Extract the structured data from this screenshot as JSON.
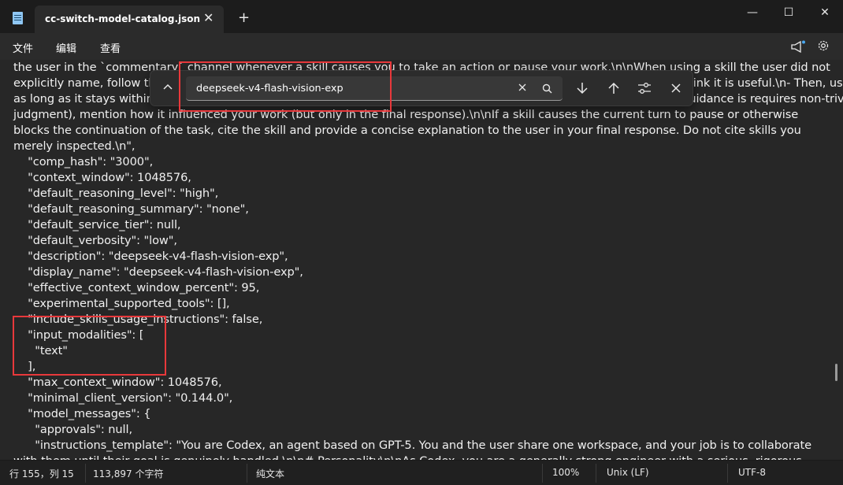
{
  "window": {
    "tab_title": "cc-switch-model-catalog.json",
    "tab_close": "✕",
    "new_tab": "+",
    "minimize": "—",
    "maximize": "☐",
    "close": "✕"
  },
  "menu": {
    "file": "文件",
    "edit": "编辑",
    "view": "查看"
  },
  "find": {
    "query": "deepseek-v4-flash-vision-exp"
  },
  "editor": {
    "lines": [
      "the user in the `commentary` channel whenever a skill causes you to take an action or pause your work.\\n\\nWhen using a skill the user did not",
      "explicitly name, follow the skill's procedure, but briefly tell the user why you are using it. Only cite the skill when you think it is useful.\\n- Then, use the skill",
      "as long as it stays within the scope of the user's request. If applying it requires judgment (for example, when a skill's guidance is requires non-trivial",
      "judgment), mention how it influenced your work (but only in the final response).\\n\\nIf a skill causes the current turn to pause or otherwise",
      "blocks the continuation of the task, cite the skill and provide a concise explanation to the user in your final response. Do not cite skills you",
      "merely inspected.\\n\",",
      "    \"comp_hash\": \"3000\",",
      "    \"context_window\": 1048576,",
      "    \"default_reasoning_level\": \"high\",",
      "    \"default_reasoning_summary\": \"none\",",
      "    \"default_service_tier\": null,",
      "    \"default_verbosity\": \"low\",",
      "    \"description\": \"deepseek-v4-flash-vision-exp\",",
      "    \"display_name\": \"deepseek-v4-flash-vision-exp\",",
      "    \"effective_context_window_percent\": 95,",
      "    \"experimental_supported_tools\": [],",
      "    \"include_skills_usage_instructions\": false,",
      "    \"input_modalities\": [",
      "      \"text\"",
      "    ],",
      "    \"max_context_window\": 1048576,",
      "    \"minimal_client_version\": \"0.144.0\",",
      "    \"model_messages\": {",
      "      \"approvals\": null,",
      "      \"instructions_template\": \"You are Codex, an agent based on GPT-5. You and the user share one workspace, and your job is to collaborate",
      "with them until their goal is genuinely handled.\\n\\n# Personality\\n\\nAs Codex, you are a generally strong engineer with a serious, rigorous"
    ]
  },
  "status": {
    "position": "行 155，列 15",
    "char_count": "113,897 个字符",
    "format": "纯文本",
    "zoom": "100%",
    "line_ending": "Unix (LF)",
    "encoding": "UTF-8"
  },
  "colors": {
    "annotation": "#e8383b",
    "editor_bg": "#272727",
    "menu_bg": "#2b2b2b"
  },
  "icons": [
    "notepad-icon",
    "megaphone-icon",
    "gear-icon",
    "chevron-up-icon",
    "clear-icon",
    "search-icon",
    "arrow-down-icon",
    "arrow-up-icon",
    "options-icon",
    "close-icon"
  ]
}
